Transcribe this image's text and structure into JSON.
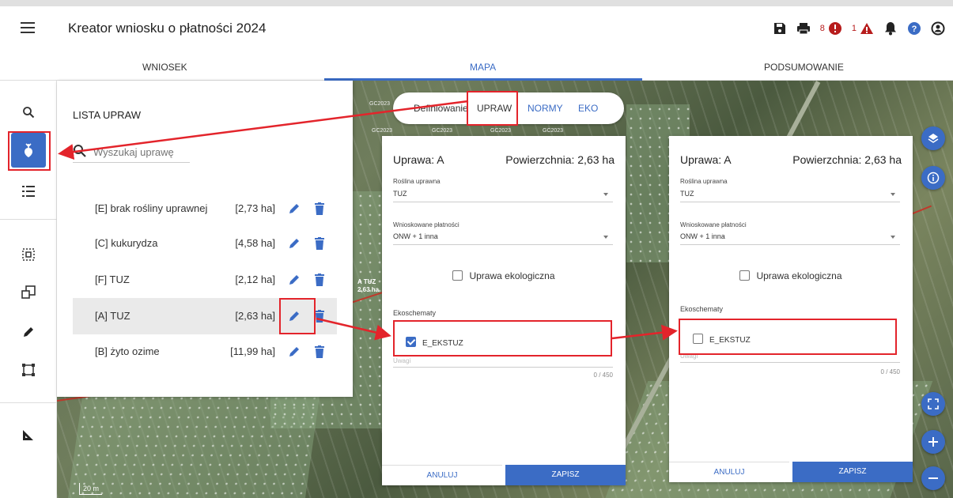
{
  "app": {
    "title": "Kreator wniosku o płatności 2024"
  },
  "header": {
    "error_count": "8",
    "warning_count": "1"
  },
  "tabs": [
    {
      "label": "WNIOSEK"
    },
    {
      "label": "MAPA"
    },
    {
      "label": "PODSUMOWANIE"
    }
  ],
  "crop_list": {
    "title": "LISTA UPRAW",
    "search_placeholder": "Wyszukaj uprawę",
    "rows": [
      {
        "name": "[E] brak rośliny uprawnej",
        "area": "[2,73 ha]"
      },
      {
        "name": "[C] kukurydza",
        "area": "[4,58 ha]"
      },
      {
        "name": "[F] TUZ",
        "area": "[2,12 ha]"
      },
      {
        "name": "[A] TUZ",
        "area": "[2,63 ha]"
      },
      {
        "name": "[B] żyto ozime",
        "area": "[11,99 ha]"
      }
    ]
  },
  "mode_selector": {
    "items": [
      "Definiowanie",
      "UPRAW",
      "NORMY",
      "EKO"
    ]
  },
  "form_left": {
    "title": "Uprawa: A",
    "area": "Powierzchnia: 2,63 ha",
    "crop_label": "Roślina uprawna",
    "crop_value": "TUZ",
    "payments_label": "Wnioskowane płatności",
    "payments_value": "ONW + 1 inna",
    "eco_label": "Uprawa ekologiczna",
    "ekoschematy_label": "Ekoschematy",
    "ekstuz_label": "E_EKSTUZ",
    "ekstuz_checked": true,
    "uwagi_label": "Uwagi",
    "counter": "0 / 450",
    "cancel_label": "ANULUJ",
    "save_label": "ZAPISZ"
  },
  "form_right": {
    "title": "Uprawa: A",
    "area": "Powierzchnia: 2,63 ha",
    "crop_label": "Roślina uprawna",
    "crop_value": "TUZ",
    "payments_label": "Wnioskowane płatności",
    "payments_value": "ONW + 1 inna",
    "eco_label": "Uprawa ekologiczna",
    "ekoschematy_label": "Ekoschematy",
    "ekstuz_label": "E_EKSTUZ",
    "ekstuz_checked": false,
    "uwagi_label": "Uwagi",
    "counter": "0 / 450",
    "cancel_label": "ANULUJ",
    "save_label": "ZAPISZ"
  },
  "map": {
    "scale": "20 m",
    "gc_labels": [
      "GC2023",
      "GC2023",
      "GC2023",
      "GC2023",
      "GC2023"
    ],
    "parcel_label": "A TUZ 2,63 ha"
  },
  "colors": {
    "accent": "#3b6cc5",
    "highlight": "#e3242b",
    "error": "#b71c1c"
  },
  "icons": {
    "rail": [
      "search-icon",
      "crop-icon",
      "list-icon",
      "select-area-icon",
      "copy-icon",
      "pencil-icon",
      "bbox-icon",
      "ruler-icon"
    ],
    "header": [
      "save-icon",
      "print-icon",
      "error-icon",
      "warning-icon",
      "bell-icon",
      "help-icon",
      "account-icon"
    ]
  }
}
